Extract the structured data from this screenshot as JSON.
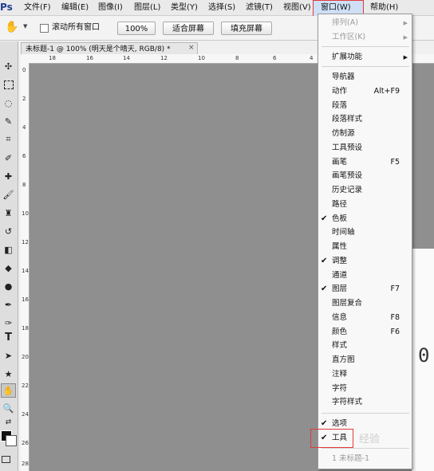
{
  "app": {
    "logo": "Ps",
    "menus": [
      "文件(F)",
      "编辑(E)",
      "图像(I)",
      "图层(L)",
      "类型(Y)",
      "选择(S)",
      "滤镜(T)",
      "视图(V)",
      "窗口(W)",
      "帮助(H)"
    ]
  },
  "options_bar": {
    "scroll_all_windows": "滚动所有窗口",
    "zoom_100": "100%",
    "fit_screen": "适合屏幕",
    "fill_screen": "填充屏幕"
  },
  "document": {
    "tab_title": "未标题-1 @ 100% (明天是个晴天, RGB/8) *",
    "ruler_top": [
      "18",
      "16",
      "14",
      "12",
      "10",
      "8",
      "6",
      "4",
      "2"
    ],
    "ruler_left": [
      "0",
      "2",
      "4",
      "6",
      "8",
      "10",
      "12",
      "14",
      "16",
      "18",
      "20",
      "22",
      "24",
      "26",
      "28"
    ],
    "canvas_text": "0"
  },
  "window_menu": {
    "arrange": "排列(A)",
    "workspace": "工作区(K)",
    "extensions": "扩展功能",
    "items": [
      {
        "label": "导航器",
        "shortcut": "",
        "checked": false
      },
      {
        "label": "动作",
        "shortcut": "Alt+F9",
        "checked": false
      },
      {
        "label": "段落",
        "shortcut": "",
        "checked": false
      },
      {
        "label": "段落样式",
        "shortcut": "",
        "checked": false
      },
      {
        "label": "仿制源",
        "shortcut": "",
        "checked": false
      },
      {
        "label": "工具预设",
        "shortcut": "",
        "checked": false
      },
      {
        "label": "画笔",
        "shortcut": "F5",
        "checked": false
      },
      {
        "label": "画笔预设",
        "shortcut": "",
        "checked": false
      },
      {
        "label": "历史记录",
        "shortcut": "",
        "checked": false
      },
      {
        "label": "路径",
        "shortcut": "",
        "checked": false
      },
      {
        "label": "色板",
        "shortcut": "",
        "checked": true
      },
      {
        "label": "时间轴",
        "shortcut": "",
        "checked": false
      },
      {
        "label": "属性",
        "shortcut": "",
        "checked": false
      },
      {
        "label": "调整",
        "shortcut": "",
        "checked": true
      },
      {
        "label": "通道",
        "shortcut": "",
        "checked": false
      },
      {
        "label": "图层",
        "shortcut": "F7",
        "checked": true
      },
      {
        "label": "图层复合",
        "shortcut": "",
        "checked": false
      },
      {
        "label": "信息",
        "shortcut": "F8",
        "checked": false
      },
      {
        "label": "颜色",
        "shortcut": "F6",
        "checked": false
      },
      {
        "label": "样式",
        "shortcut": "",
        "checked": false
      },
      {
        "label": "直方图",
        "shortcut": "",
        "checked": false
      },
      {
        "label": "注释",
        "shortcut": "",
        "checked": false
      },
      {
        "label": "字符",
        "shortcut": "",
        "checked": false
      },
      {
        "label": "字符样式",
        "shortcut": "",
        "checked": false
      }
    ],
    "options": "选项",
    "tools": "工具",
    "open_document": "1 未标题-1",
    "check_mark": "✔"
  },
  "watermark": "经验"
}
